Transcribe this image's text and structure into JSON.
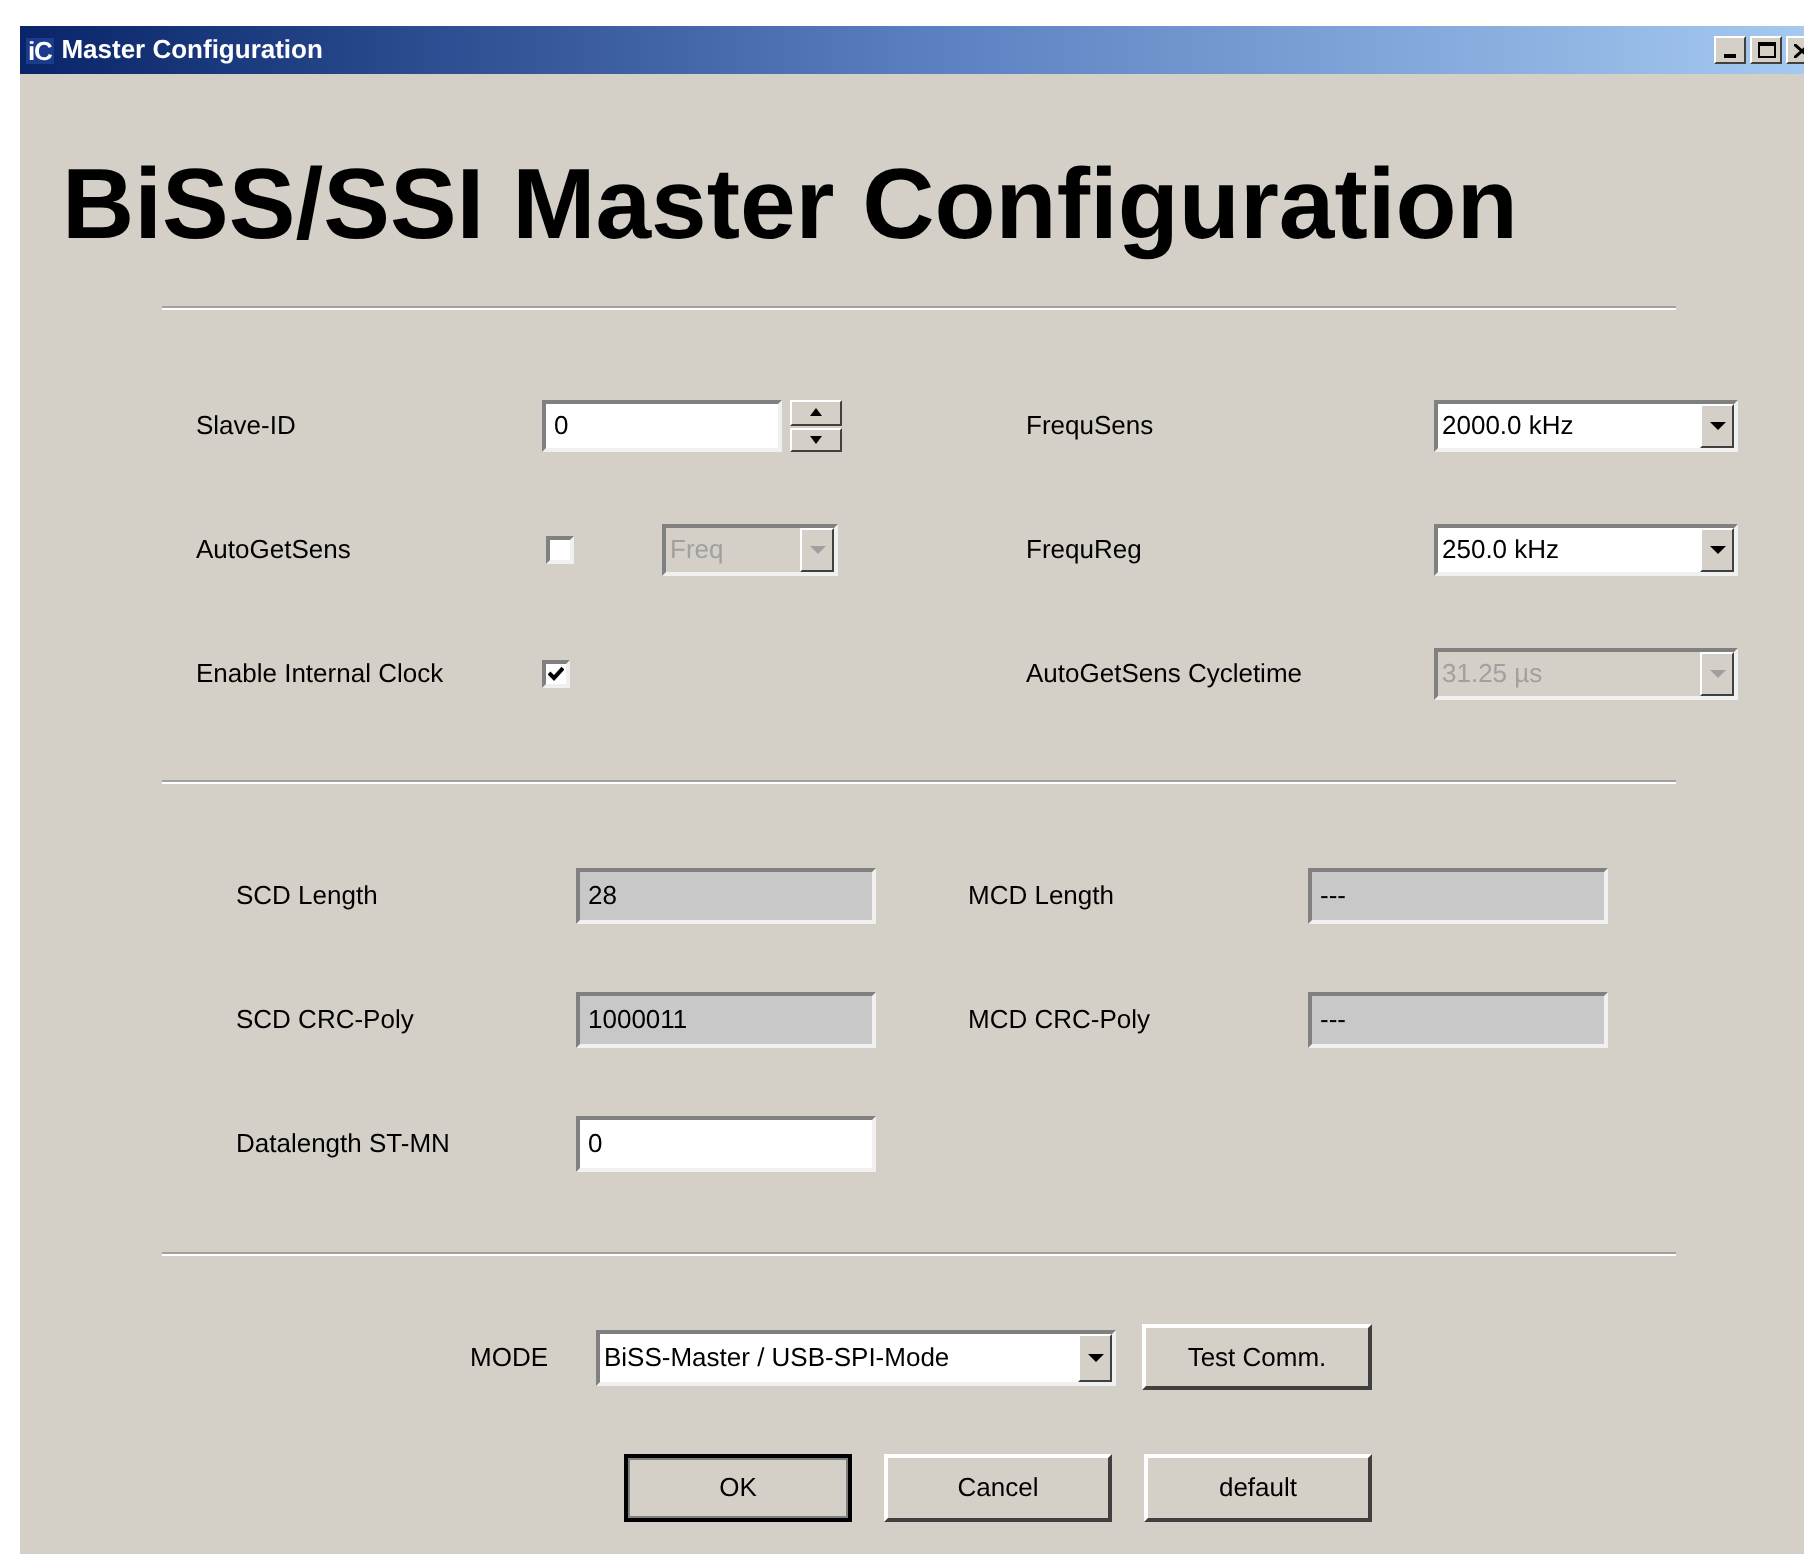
{
  "window": {
    "logo": "iC",
    "title": "Master Configuration"
  },
  "heading": "BiSS/SSI Master Configuration",
  "general_rows": [
    {
      "left": {
        "label": "Slave-ID",
        "kind": "spinner",
        "value": "0"
      },
      "right": {
        "label": "FrequSens",
        "kind": "dropdown",
        "value": "2000.0 kHz",
        "disabled": false
      }
    },
    {
      "left": {
        "label": "AutoGetSens",
        "kind": "checkbox",
        "checked": false,
        "combo": {
          "value": "Freq",
          "disabled": true
        }
      },
      "right": {
        "label": "FrequReg",
        "kind": "dropdown",
        "value": "250.0 kHz",
        "disabled": false
      }
    },
    {
      "left": {
        "label": "Enable Internal Clock",
        "kind": "checkbox",
        "checked": true
      },
      "right": {
        "label": "AutoGetSens Cycletime",
        "kind": "dropdown",
        "value": "31.25 µs",
        "disabled": true
      }
    }
  ],
  "frame_rows": [
    {
      "left": {
        "label": "SCD Length",
        "value": "28",
        "disabled": true
      },
      "right": {
        "label": "MCD Length",
        "value": "---",
        "disabled": true
      }
    },
    {
      "left": {
        "label": "SCD CRC-Poly",
        "value": "1000011",
        "disabled": true
      },
      "right": {
        "label": "MCD CRC-Poly",
        "value": "---",
        "disabled": true
      }
    },
    {
      "left": {
        "label": "Datalength ST-MN",
        "value": "0",
        "disabled": false
      }
    }
  ],
  "mode": {
    "label": "MODE",
    "value": "BiSS-Master / USB-SPI-Mode",
    "button": "Test Comm."
  },
  "buttons": [
    {
      "label": "OK",
      "default": true
    },
    {
      "label": "Cancel",
      "default": false
    },
    {
      "label": "default",
      "default": false
    }
  ]
}
